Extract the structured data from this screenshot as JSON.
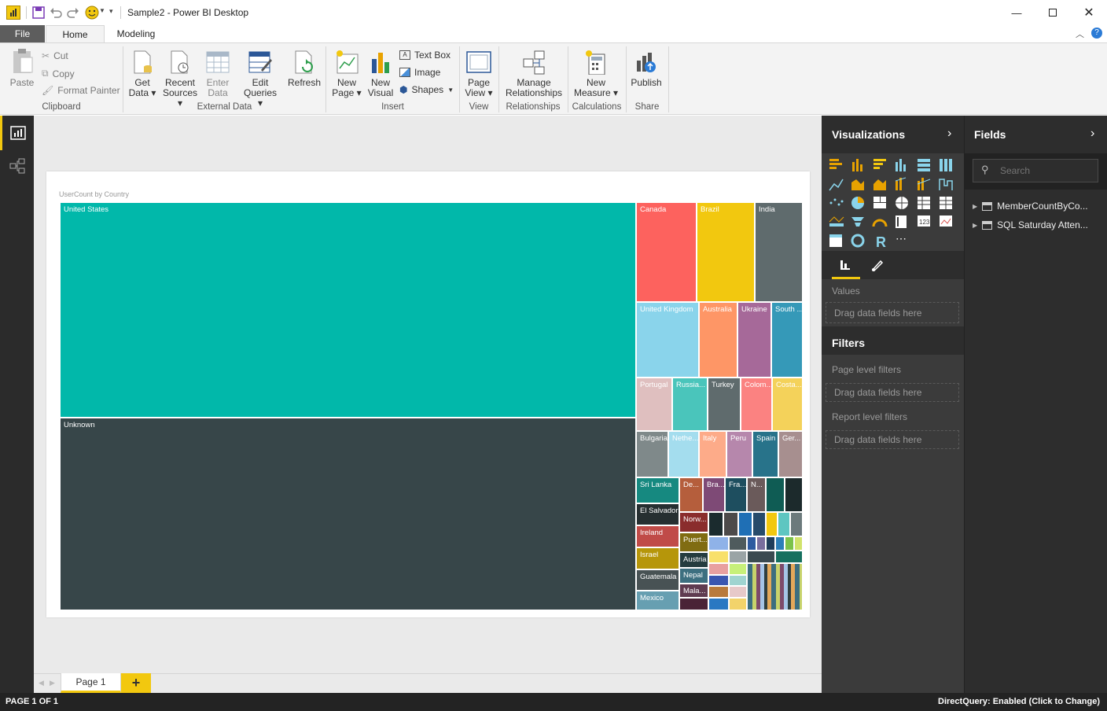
{
  "window": {
    "title": "Sample2 - Power BI Desktop"
  },
  "tabs": {
    "file": "File",
    "home": "Home",
    "modeling": "Modeling"
  },
  "ribbon": {
    "paste": "Paste",
    "cut": "Cut",
    "copy": "Copy",
    "format_painter": "Format Painter",
    "clipboard": "Clipboard",
    "get_data_1": "Get",
    "get_data_2": "Data",
    "recent_1": "Recent",
    "recent_2": "Sources",
    "enter_1": "Enter",
    "enter_2": "Data",
    "edit_1": "Edit",
    "edit_2": "Queries",
    "refresh": "Refresh",
    "external_data": "External Data",
    "new_page_1": "New",
    "new_page_2": "Page",
    "new_visual_1": "New",
    "new_visual_2": "Visual",
    "text_box": "Text Box",
    "image": "Image",
    "shapes": "Shapes",
    "insert": "Insert",
    "page_view_1": "Page",
    "page_view_2": "View",
    "view": "View",
    "manage_1": "Manage",
    "manage_2": "Relationships",
    "relationships": "Relationships",
    "new_measure_1": "New",
    "new_measure_2": "Measure",
    "calculations": "Calculations",
    "publish": "Publish",
    "share": "Share"
  },
  "visual": {
    "title": "UserCount by Country"
  },
  "chart_data": {
    "type": "treemap",
    "title": "UserCount by Country",
    "items": [
      "United States",
      "Unknown",
      "Canada",
      "Brazil",
      "India",
      "United Kingdom",
      "Australia",
      "Ukraine",
      "South ...",
      "Portugal",
      "Russia...",
      "Turkey",
      "Colom...",
      "Costa...",
      "Bulgaria",
      "Nethe...",
      "Italy",
      "Peru",
      "Spain",
      "Ger...",
      "Sri Lanka",
      "De...",
      "Bra...",
      "Fra...",
      "N...",
      "El Salvador",
      "Norw...",
      "Ireland",
      "Puert...",
      "Israel",
      "Austria",
      "Guatemala",
      "Nepal",
      "Mala...",
      "Mexico"
    ]
  },
  "pages": {
    "page1": "Page 1",
    "add": "+"
  },
  "visualizations": {
    "title": "Visualizations",
    "values": "Values",
    "drag": "Drag data fields here"
  },
  "filters": {
    "title": "Filters",
    "page_level": "Page level filters",
    "report_level": "Report level filters",
    "drag": "Drag data fields here"
  },
  "fields": {
    "title": "Fields",
    "search_placeholder": "Search",
    "table1": "MemberCountByCo...",
    "table2": "SQL Saturday Atten..."
  },
  "status": {
    "left": "PAGE 1 OF 1",
    "right": "DirectQuery: Enabled (Click to Change)"
  },
  "colors": {
    "teal": "#01b8aa",
    "dark": "#374649",
    "red": "#fd625e",
    "yellow": "#f2c80f",
    "grey": "#5f6b6d",
    "accent": "#f2c80f"
  }
}
